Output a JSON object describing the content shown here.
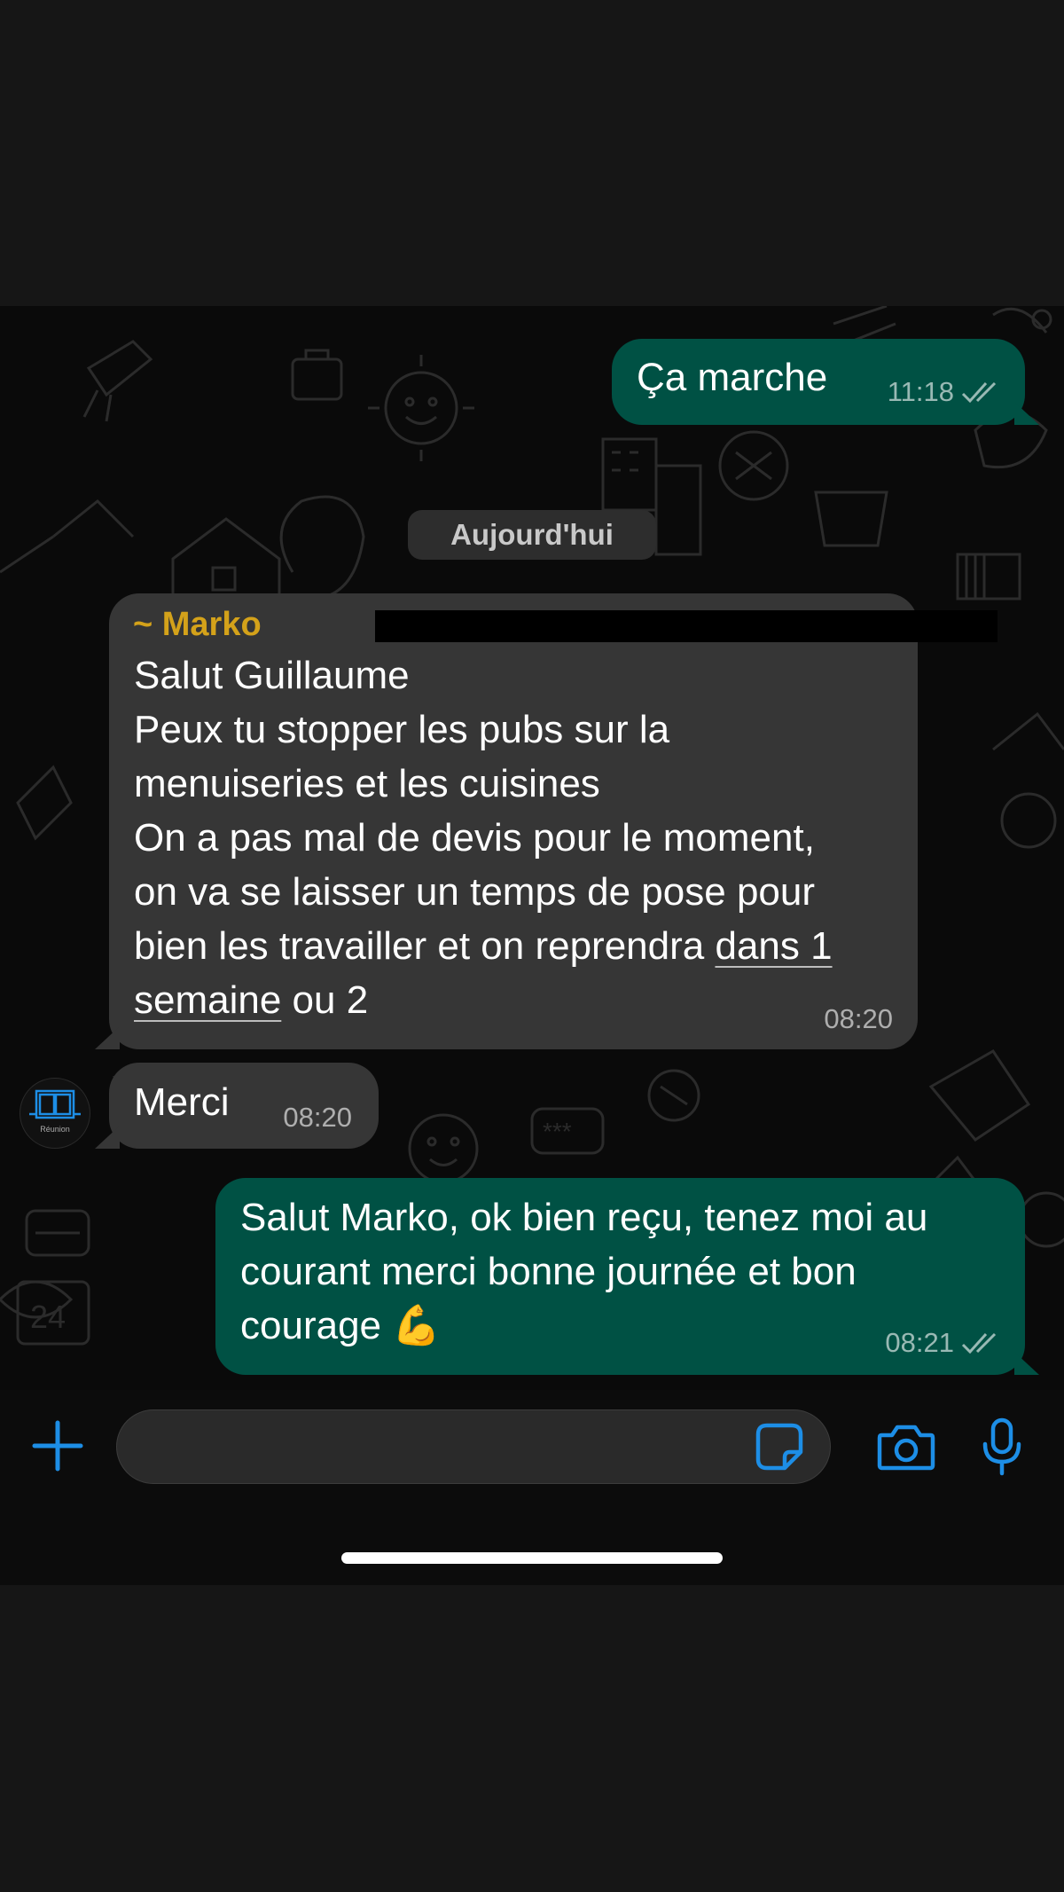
{
  "chat": {
    "date_separator": "Aujourd'hui",
    "messages": [
      {
        "direction": "outgoing",
        "text": "Ça marche",
        "time": "11:18",
        "status": "read"
      },
      {
        "direction": "incoming",
        "sender": "~ Marko",
        "text_intro": "Salut Guillaume\nPeux tu stopper les pubs sur la\nmenuiseries et les cuisines\nOn a pas mal de devis pour le moment,\non va se laisser un temps de pose pour\nbien les travailler et on reprendra ",
        "link_1": "dans 1",
        "link_2": "semaine",
        "text_outro": " ou 2",
        "time": "08:20"
      },
      {
        "direction": "incoming",
        "text": "Merci",
        "time": "08:20",
        "avatar_text": "Réunion"
      },
      {
        "direction": "outgoing",
        "text": "Salut Marko, ok bien reçu, tenez moi au\ncourant merci bonne journée et bon\ncourage 💪",
        "time": "08:21",
        "status": "read"
      }
    ]
  },
  "composer": {
    "icons": [
      "plus-icon",
      "sticker-icon",
      "camera-icon",
      "microphone-icon"
    ]
  },
  "colors": {
    "outgoing_bubble": "#005144",
    "incoming_bubble": "#363636",
    "sender_name": "#d4a21a",
    "accent_blue": "#1d8ee6"
  }
}
